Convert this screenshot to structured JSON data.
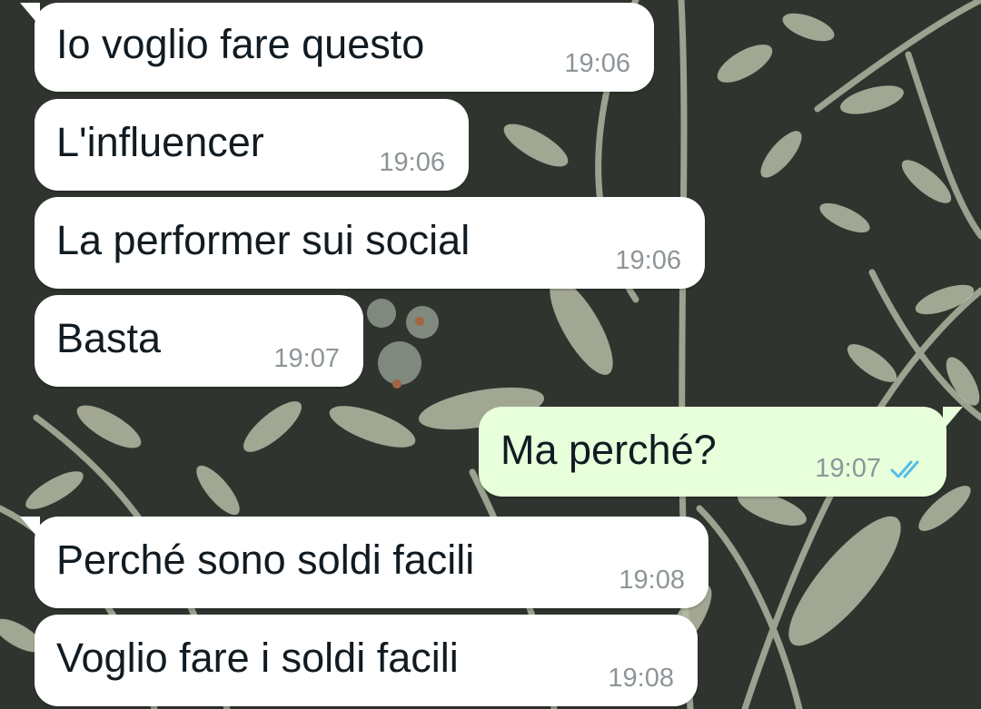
{
  "colors": {
    "incoming_bubble": "#ffffff",
    "outgoing_bubble": "#e7ffdb",
    "text": "#111b21",
    "timestamp": "#8d9598",
    "read_ticks": "#53bdeb"
  },
  "messages": [
    {
      "direction": "incoming",
      "text": "Io voglio fare questo",
      "time": "19:06"
    },
    {
      "direction": "incoming",
      "text": "L'influencer",
      "time": "19:06"
    },
    {
      "direction": "incoming",
      "text": "La performer sui social",
      "time": "19:06"
    },
    {
      "direction": "incoming",
      "text": "Basta",
      "time": "19:07"
    },
    {
      "direction": "outgoing",
      "text": "Ma perché?",
      "time": "19:07",
      "status_icon": "double-check-read-icon"
    },
    {
      "direction": "incoming",
      "text": "Perché sono soldi facili",
      "time": "19:08"
    },
    {
      "direction": "incoming",
      "text": "Voglio fare i soldi facili",
      "time": "19:08"
    }
  ]
}
